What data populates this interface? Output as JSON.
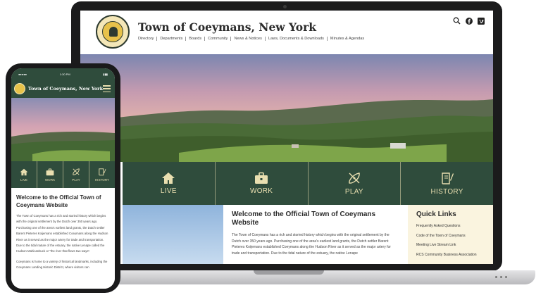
{
  "site": {
    "title": "Town of Coeymans, New York",
    "nav": [
      "Directory",
      "Departments",
      "Boards",
      "Community",
      "News & Notices",
      "Laws, Documents & Downloads",
      "Minutes & Agendas"
    ],
    "header_icons": [
      "search-icon",
      "facebook-icon",
      "vimeo-icon"
    ]
  },
  "tiles": [
    {
      "label": "LIVE",
      "icon": "house-icon"
    },
    {
      "label": "WORK",
      "icon": "briefcase-icon"
    },
    {
      "label": "PLAY",
      "icon": "kayak-icon"
    },
    {
      "label": "HISTORY",
      "icon": "book-icon"
    }
  ],
  "welcome": {
    "heading": "Welcome to the Official Town of Coeymans Website",
    "paragraph": "The Town of Coeymans has a rich and storied history which begins with the original settlement by the Dutch over 350 years ago. Purchasing one of the area's earliest land grants, the Dutch settler Barent Pieteres Koijemans established Coeymans along the Hudson River as it served as the major artery for trade and transportation. Due to the tidal nature of the estuary, the native Lenape"
  },
  "quick_links": {
    "heading": "Quick Links",
    "links": [
      "Frequently Asked Questions",
      "Code of the Town of Coeymans",
      "Meeting Live Stream Link",
      "RCS Community Business Association"
    ]
  },
  "phone": {
    "status_time": "1:30 PM",
    "title": "Town of Coeymans, New York",
    "welcome_heading": "Welcome to the Official Town of Coeymans Website",
    "paragraph_1": "The Town of Coeymans has a rich and storied history which begins with the original settlement by the Dutch over 350 years ago. Purchasing one of the area's earliest land grants, the Dutch settler Barent Pieteres Koijemans established Coeymans along the Hudson River as it served as the major artery for trade and transportation. Due to the tidal nature of the estuary, the native Lenape called the Hudson Mahicanituck or \"the river that flows two ways\".",
    "paragraph_2": "Coeymans is home to a variety of historical landmarks, including the Coeymans Landing Historic District, where visitors can"
  },
  "colors": {
    "brand_green": "#2f4c3c",
    "tile_text": "#e9dfb0",
    "quick_links_bg": "#faf4df"
  }
}
